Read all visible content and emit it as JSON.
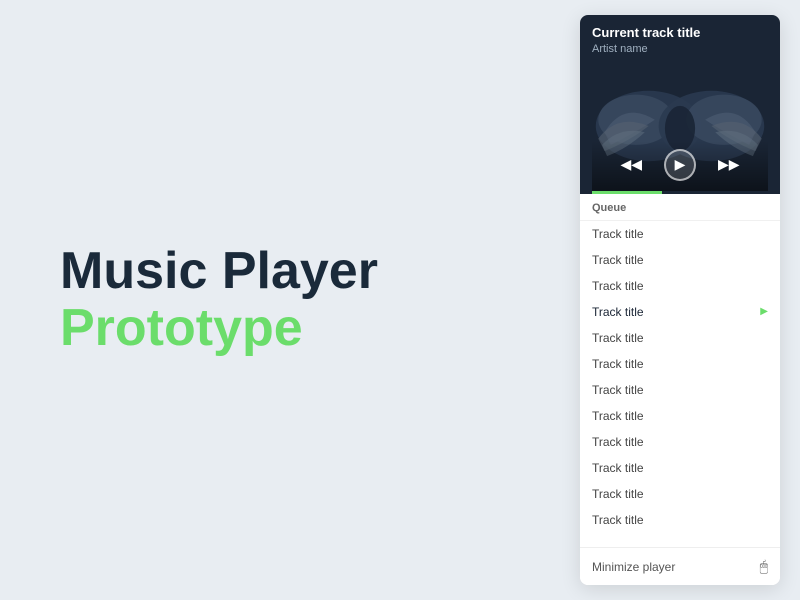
{
  "branding": {
    "title": "Music Player",
    "subtitle": "Prototype"
  },
  "player": {
    "current_track": "Current track title",
    "artist": "Artist name",
    "queue_label": "Queue",
    "minimize_label": "Minimize player",
    "queue_items": [
      {
        "id": 1,
        "title": "Track title",
        "active": false
      },
      {
        "id": 2,
        "title": "Track title",
        "active": false
      },
      {
        "id": 3,
        "title": "Track title",
        "active": false
      },
      {
        "id": 4,
        "title": "Track title",
        "active": true
      },
      {
        "id": 5,
        "title": "Track title",
        "active": false
      },
      {
        "id": 6,
        "title": "Track title",
        "active": false
      },
      {
        "id": 7,
        "title": "Track title",
        "active": false
      },
      {
        "id": 8,
        "title": "Track title",
        "active": false
      },
      {
        "id": 9,
        "title": "Track title",
        "active": false
      },
      {
        "id": 10,
        "title": "Track title",
        "active": false
      },
      {
        "id": 11,
        "title": "Track title",
        "active": false
      },
      {
        "id": 12,
        "title": "Track title",
        "active": false
      }
    ],
    "controls": {
      "prev": "⏮",
      "play": "▶",
      "next": "⏭"
    }
  },
  "colors": {
    "accent": "#6bdd6b",
    "dark_bg": "#1a2535",
    "text_dark": "#1a2a3a"
  }
}
